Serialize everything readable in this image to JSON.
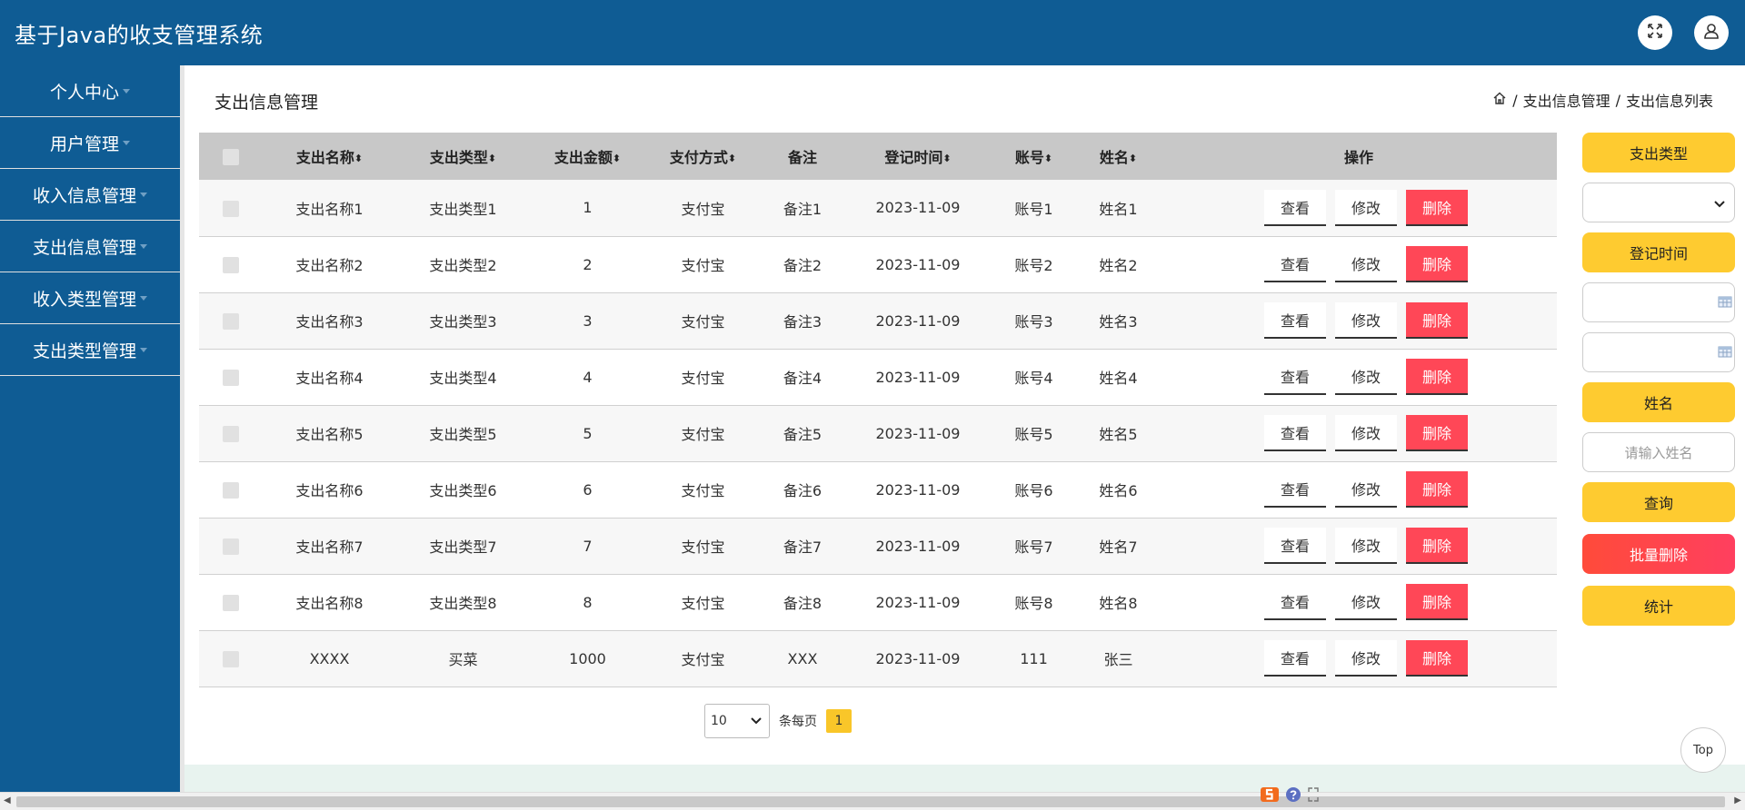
{
  "header": {
    "app_title": "基于Java的收支管理系统",
    "icons": [
      "fullscreen-icon",
      "user-icon"
    ]
  },
  "sidebar": {
    "items": [
      {
        "label": "个人中心"
      },
      {
        "label": "用户管理"
      },
      {
        "label": "收入信息管理"
      },
      {
        "label": "支出信息管理"
      },
      {
        "label": "收入类型管理"
      },
      {
        "label": "支出类型管理"
      }
    ]
  },
  "page": {
    "title": "支出信息管理",
    "breadcrumb": [
      "支出信息管理",
      "支出信息列表"
    ],
    "breadcrumb_sep": "/"
  },
  "table": {
    "columns": [
      "支出名称",
      "支出类型",
      "支出金额",
      "支付方式",
      "备注",
      "登记时间",
      "账号",
      "姓名",
      "操作"
    ],
    "rows": [
      [
        "支出名称1",
        "支出类型1",
        "1",
        "支付宝",
        "备注1",
        "2023-11-09",
        "账号1",
        "姓名1"
      ],
      [
        "支出名称2",
        "支出类型2",
        "2",
        "支付宝",
        "备注2",
        "2023-11-09",
        "账号2",
        "姓名2"
      ],
      [
        "支出名称3",
        "支出类型3",
        "3",
        "支付宝",
        "备注3",
        "2023-11-09",
        "账号3",
        "姓名3"
      ],
      [
        "支出名称4",
        "支出类型4",
        "4",
        "支付宝",
        "备注4",
        "2023-11-09",
        "账号4",
        "姓名4"
      ],
      [
        "支出名称5",
        "支出类型5",
        "5",
        "支付宝",
        "备注5",
        "2023-11-09",
        "账号5",
        "姓名5"
      ],
      [
        "支出名称6",
        "支出类型6",
        "6",
        "支付宝",
        "备注6",
        "2023-11-09",
        "账号6",
        "姓名6"
      ],
      [
        "支出名称7",
        "支出类型7",
        "7",
        "支付宝",
        "备注7",
        "2023-11-09",
        "账号7",
        "姓名7"
      ],
      [
        "支出名称8",
        "支出类型8",
        "8",
        "支付宝",
        "备注8",
        "2023-11-09",
        "账号8",
        "姓名8"
      ],
      [
        "XXXX",
        "买菜",
        "1000",
        "支付宝",
        "XXX",
        "2023-11-09",
        "111",
        "张三"
      ]
    ],
    "actions": {
      "view": "查看",
      "edit": "修改",
      "delete": "删除"
    }
  },
  "pagination": {
    "page_size": "10",
    "per_page_label": "条每页",
    "current_page": "1"
  },
  "filters": {
    "type_label": "支出类型",
    "type_value": "",
    "date_label": "登记时间",
    "name_label": "姓名",
    "name_placeholder": "请输入姓名",
    "search_button": "查询",
    "batch_delete_button": "批量删除",
    "stats_button": "统计"
  },
  "back_to_top": "Top",
  "colors": {
    "header_bg": "#0f5c94",
    "accent_yellow": "#fecb30",
    "danger_red": "#ff4757"
  }
}
